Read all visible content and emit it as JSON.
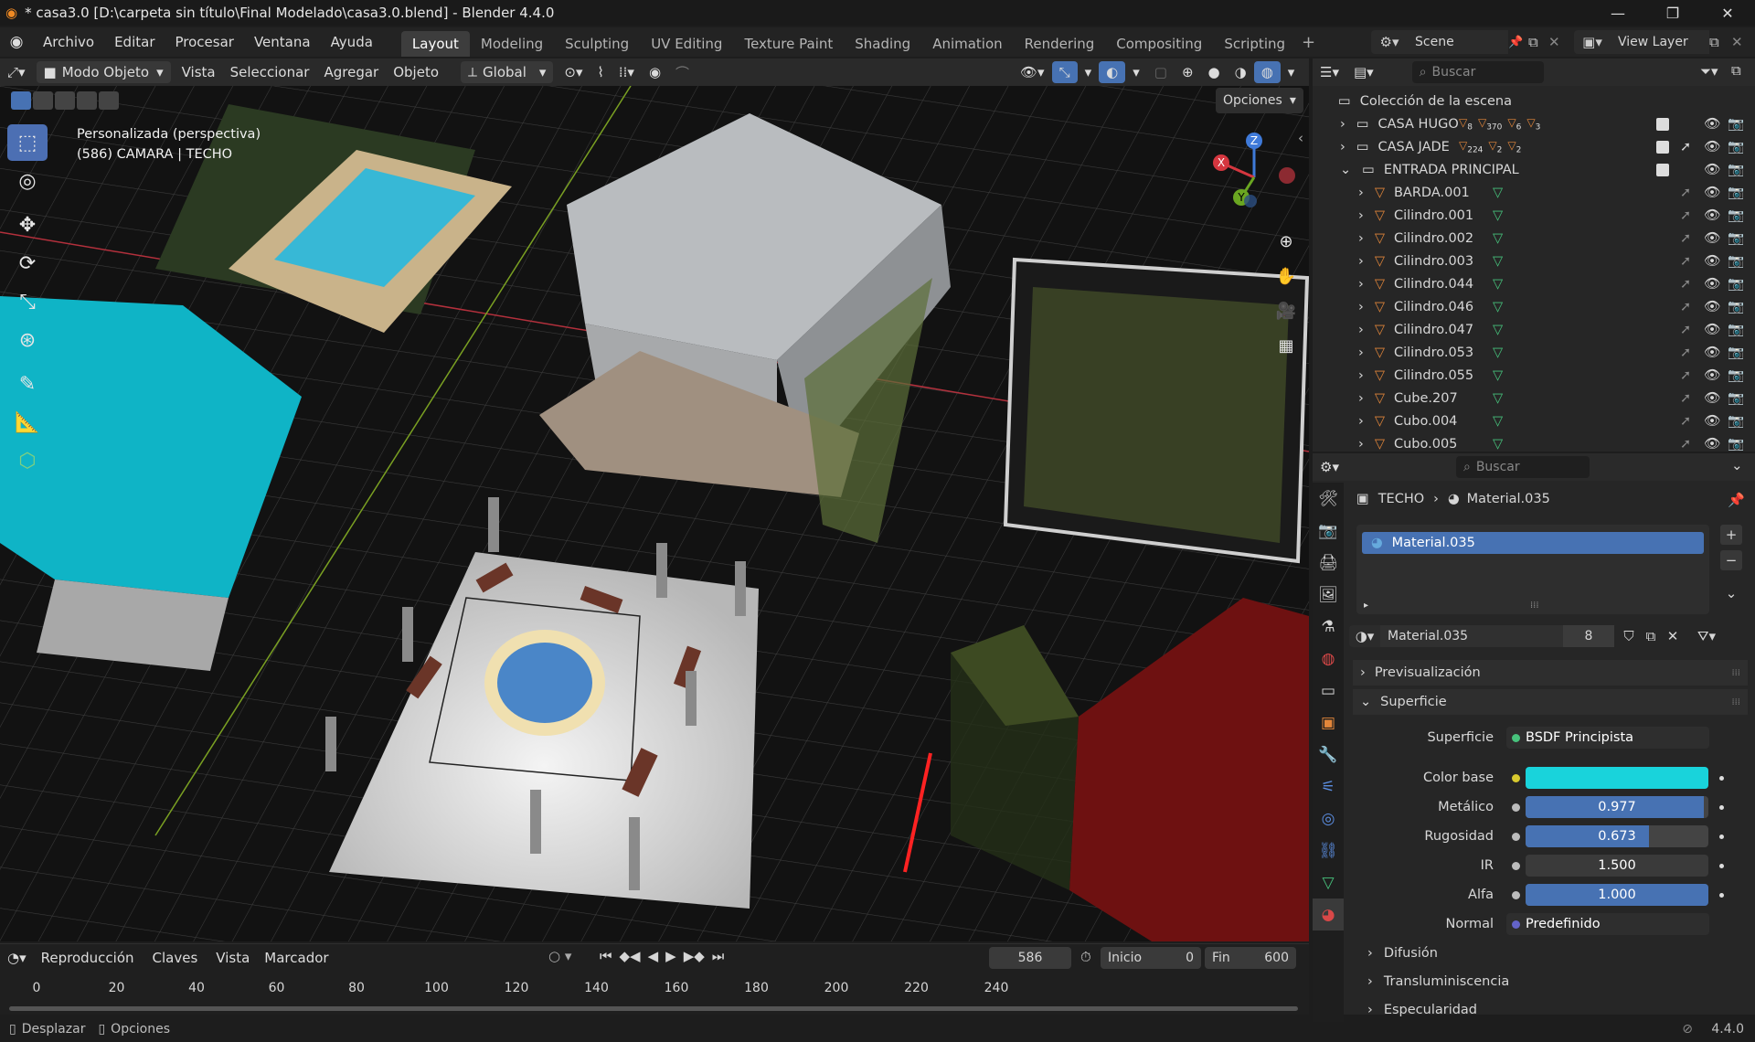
{
  "window": {
    "title": "* casa3.0 [D:\\carpeta sin título\\Final Modelado\\casa3.0.blend] - Blender 4.4.0"
  },
  "menu": [
    "Archivo",
    "Editar",
    "Procesar",
    "Ventana",
    "Ayuda"
  ],
  "workspaces": [
    {
      "label": "Layout",
      "active": true
    },
    {
      "label": "Modeling"
    },
    {
      "label": "Sculpting"
    },
    {
      "label": "UV Editing"
    },
    {
      "label": "Texture Paint"
    },
    {
      "label": "Shading"
    },
    {
      "label": "Animation"
    },
    {
      "label": "Rendering"
    },
    {
      "label": "Compositing"
    },
    {
      "label": "Scripting"
    }
  ],
  "scene": {
    "name": "Scene",
    "view_layer": "View Layer"
  },
  "viewport_header": {
    "mode": "Modo Objeto",
    "menus": [
      "Vista",
      "Seleccionar",
      "Agregar",
      "Objeto"
    ],
    "transform": "Global",
    "options": "Opciones"
  },
  "viewport": {
    "view_name": "Personalizada (perspectiva)",
    "object_info": "(586) CAMARA | TECHO",
    "axes": {
      "x": "X",
      "y": "Y",
      "z": "Z"
    }
  },
  "timeline": {
    "menus": [
      "Reproducción",
      "Claves",
      "Vista",
      "Marcador"
    ],
    "current_frame": "586",
    "start_label": "Inicio",
    "start": "0",
    "end_label": "Fin",
    "end": "600",
    "ticks": [
      "0",
      "20",
      "40",
      "60",
      "80",
      "100",
      "120",
      "140",
      "160",
      "180",
      "200",
      "220",
      "240"
    ]
  },
  "statusbar": {
    "left1": "Desplazar",
    "left2": "Opciones",
    "version": "4.4.0"
  },
  "outliner": {
    "search_placeholder": "Buscar",
    "root": "Colección de la escena",
    "collections": [
      {
        "name": "CASA HUGO",
        "counts": [
          "8",
          "370",
          "6",
          "3"
        ]
      },
      {
        "name": "CASA JADE",
        "counts": [
          "224",
          "2",
          "2"
        ]
      },
      {
        "name": "ENTRADA PRINCIPAL"
      }
    ],
    "objects": [
      "BARDA.001",
      "Cilindro.001",
      "Cilindro.002",
      "Cilindro.003",
      "Cilindro.044",
      "Cilindro.046",
      "Cilindro.047",
      "Cilindro.053",
      "Cilindro.055",
      "Cube.207",
      "Cubo.004",
      "Cubo.005"
    ]
  },
  "properties": {
    "search_placeholder": "Buscar",
    "breadcrumb_object": "TECHO",
    "breadcrumb_material": "Material.035",
    "slot": "Material.035",
    "material_name": "Material.035",
    "users": "8",
    "sections": {
      "preview": "Previsualización",
      "surface": "Superficie",
      "diffusion": "Difusión",
      "transmission": "Transluminiscencia",
      "specular": "Especularidad"
    },
    "rows": {
      "surface_label": "Superficie",
      "surface_value": "BSDF Principista",
      "base_color_label": "Color base",
      "base_color": "#19d3db",
      "metallic_label": "Metálico",
      "metallic": "0.977",
      "metallic_frac": 0.977,
      "roughness_label": "Rugosidad",
      "roughness": "0.673",
      "roughness_frac": 0.673,
      "ior_label": "IR",
      "ior": "1.500",
      "alpha_label": "Alfa",
      "alpha": "1.000",
      "alpha_frac": 1.0,
      "normal_label": "Normal",
      "normal_value": "Predefinido"
    }
  },
  "colors": {
    "accent": "#4772b3",
    "object_orange": "#e2863a",
    "mesh_green": "#47c27c"
  }
}
